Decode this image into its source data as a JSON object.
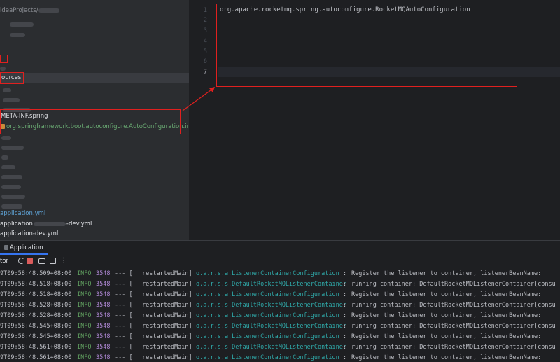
{
  "tree": {
    "breadcrumb": "ideaProjects/",
    "resources_label": "ources",
    "meta_inf_label": "META-INF.spring",
    "imports_file": "org.springframework.boot.autoconfigure.AutoConfiguration.imports",
    "app_yml": "application.yml",
    "app_partial_prefix": "application",
    "app_partial_suffix": "-dev.yml",
    "app_dev_yml": "application-dev.yml"
  },
  "editor": {
    "line_numbers": [
      "1",
      "2",
      "3",
      "4",
      "5",
      "6",
      "7"
    ],
    "current_line": "7",
    "code_line_1": "org.apache.rocketmq.spring.autoconfigure.RocketMQAutoConfiguration"
  },
  "run": {
    "tab_label": "Application",
    "toolbar_label": "tor",
    "more_glyph": "⋮",
    "logs": [
      {
        "ts": "9T09:58:48.509+08:00",
        "level": "INFO",
        "pid": "3548",
        "sep": "--- [",
        "thread": "restartedMain]",
        "logger": "o.a.r.s.a.ListenerContainerConfiguration",
        "colon": ":",
        "msg": "Register the listener to container, listenerBeanName:"
      },
      {
        "ts": "9T09:58:48.518+08:00",
        "level": "INFO",
        "pid": "3548",
        "sep": "--- [",
        "thread": "restartedMain]",
        "logger": "o.a.r.s.s.DefaultRocketMQListenerContainer",
        "colon": ":",
        "msg": "running container: DefaultRocketMQListenerContainer{consu"
      },
      {
        "ts": "9T09:58:48.518+08:00",
        "level": "INFO",
        "pid": "3548",
        "sep": "--- [",
        "thread": "restartedMain]",
        "logger": "o.a.r.s.a.ListenerContainerConfiguration",
        "colon": ":",
        "msg": "Register the listener to container, listenerBeanName:"
      },
      {
        "ts": "9T09:58:48.528+08:00",
        "level": "INFO",
        "pid": "3548",
        "sep": "--- [",
        "thread": "restartedMain]",
        "logger": "o.a.r.s.s.DefaultRocketMQListenerContainer",
        "colon": ":",
        "msg": "running container: DefaultRocketMQListenerContainer{consu"
      },
      {
        "ts": "9T09:58:48.528+08:00",
        "level": "INFO",
        "pid": "3548",
        "sep": "--- [",
        "thread": "restartedMain]",
        "logger": "o.a.r.s.a.ListenerContainerConfiguration",
        "colon": ":",
        "msg": "Register the listener to container, listenerBeanName:"
      },
      {
        "ts": "9T09:58:48.545+08:00",
        "level": "INFO",
        "pid": "3548",
        "sep": "--- [",
        "thread": "restartedMain]",
        "logger": "o.a.r.s.s.DefaultRocketMQListenerContainer",
        "colon": ":",
        "msg": "running container: DefaultRocketMQListenerContainer{consu"
      },
      {
        "ts": "9T09:58:48.545+08:00",
        "level": "INFO",
        "pid": "3548",
        "sep": "--- [",
        "thread": "restartedMain]",
        "logger": "o.a.r.s.a.ListenerContainerConfiguration",
        "colon": ":",
        "msg": "Register the listener to container, listenerBeanName:"
      },
      {
        "ts": "9T09:58:48.561+08:00",
        "level": "INFO",
        "pid": "3548",
        "sep": "--- [",
        "thread": "restartedMain]",
        "logger": "o.a.r.s.s.DefaultRocketMQListenerContainer",
        "colon": ":",
        "msg": "running container: DefaultRocketMQListenerContainer{consu"
      },
      {
        "ts": "9T09:58:48.561+08:00",
        "level": "INFO",
        "pid": "3548",
        "sep": "--- [",
        "thread": "restartedMain]",
        "logger": "o.a.r.s.a.ListenerContainerConfiguration",
        "colon": ":",
        "msg": "Register the listener to container, listenerBeanName:"
      }
    ]
  },
  "colors": {
    "annotation": "#e0201f",
    "selection": "#393b40",
    "info": "#5f9e5f",
    "logger": "#2fa8a8",
    "imports_file": "#6aab73"
  }
}
